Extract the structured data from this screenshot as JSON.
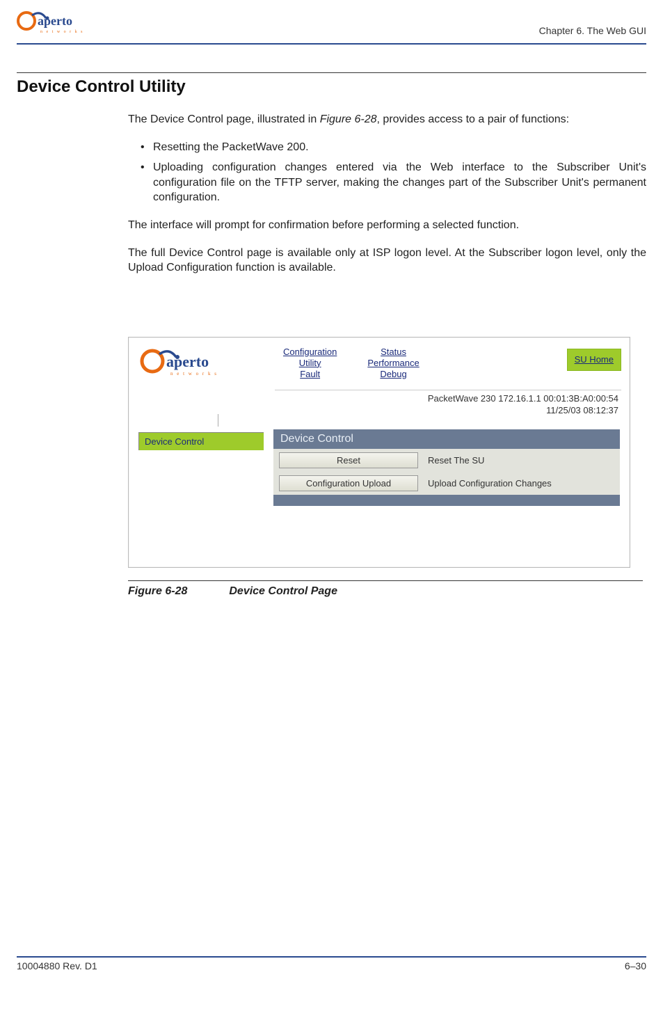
{
  "header": {
    "logo_text_main": "aperto",
    "logo_text_sub": "n e t w o r k s",
    "chapter": "Chapter 6.  The Web GUI"
  },
  "section": {
    "title": "Device Control Utility",
    "intro_pre": "The Device Control page, illustrated in ",
    "intro_figref": "Figure 6-28",
    "intro_post": ", provides access to a pair of functions:",
    "bullets": [
      "Resetting the PacketWave 200.",
      "Uploading configuration changes entered via the Web interface to the Subscriber Unit's configuration file on the TFTP server, making the changes part of the Subscriber Unit's permanent configuration."
    ],
    "para2": "The interface will prompt for confirmation before performing a selected function.",
    "para3": "The full Device Control page is available only at ISP logon level. At the Subscriber logon level, only the Upload Configuration function is available."
  },
  "figure": {
    "nav_col1": [
      "Configuration",
      "Utility",
      "Fault"
    ],
    "nav_col2": [
      "Status",
      "Performance",
      "Debug"
    ],
    "su_home": "SU Home",
    "status_line1": "PacketWave 230    172.16.1.1    00:01:3B:A0:00:54",
    "status_line2": "11/25/03    08:12:37",
    "sidebar_item": "Device Control",
    "panel_title": "Device Control",
    "rows": [
      {
        "button": "Reset",
        "desc": "Reset The SU"
      },
      {
        "button": "Configuration Upload",
        "desc": "Upload Configuration Changes"
      }
    ]
  },
  "caption": {
    "num": "Figure 6-28",
    "title": "Device Control Page"
  },
  "footer": {
    "left": "10004880 Rev. D1",
    "right": "6–30"
  }
}
